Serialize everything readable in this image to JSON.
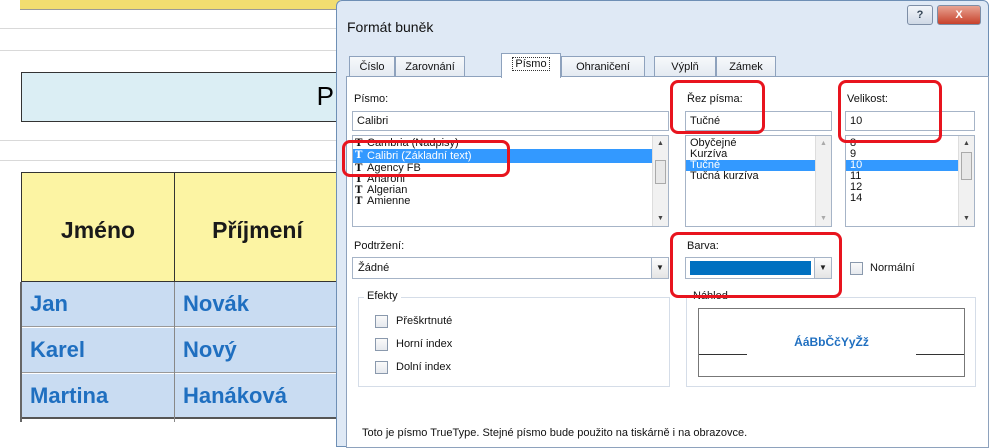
{
  "sheet": {
    "title_fragment": "P",
    "headers": [
      "Jméno",
      "Příjmení"
    ],
    "rows": [
      [
        "Jan",
        "Novák"
      ],
      [
        "Karel",
        "Nový"
      ],
      [
        "Martina",
        "Hanáková"
      ]
    ]
  },
  "dialog": {
    "title": "Formát buněk",
    "help": "?",
    "close": "X",
    "tabs": [
      "Číslo",
      "Zarovnání",
      "Písmo",
      "Ohraničení",
      "Výplň",
      "Zámek"
    ],
    "active_tab": "Písmo",
    "font": {
      "label": "Písmo:",
      "value": "Calibri",
      "items": [
        "Cambria (Nadpisy)",
        "Calibri (Základní text)",
        "Agency FB",
        "Aharoni",
        "Algerian",
        "Amienne"
      ],
      "selected": "Calibri (Základní text)"
    },
    "style": {
      "label": "Řez písma:",
      "value": "Tučné",
      "items": [
        "Obyčejné",
        "Kurzíva",
        "Tučné",
        "Tučná kurzíva"
      ],
      "selected": "Tučné"
    },
    "size": {
      "label": "Velikost:",
      "value": "10",
      "items": [
        "8",
        "9",
        "10",
        "11",
        "12",
        "14"
      ],
      "selected": "10"
    },
    "underline": {
      "label": "Podtržení:",
      "value": "Žádné"
    },
    "color": {
      "label": "Barva:",
      "swatch": "#0070c0"
    },
    "normal": {
      "label": "Normální"
    },
    "effects": {
      "label": "Efekty",
      "items": [
        "Přeškrtnuté",
        "Horní index",
        "Dolní index"
      ]
    },
    "preview": {
      "label": "Náhled",
      "text": "ÁáBbČčYyŽž"
    },
    "info": "Toto je písmo TrueType. Stejné písmo bude použito na tiskárně i na obrazovce."
  },
  "colors": {
    "highlight": "#e8141e",
    "accent_blue": "#1f6fc0",
    "header_yellow": "#fcf4a3",
    "row_blue": "#c9dcf2"
  }
}
